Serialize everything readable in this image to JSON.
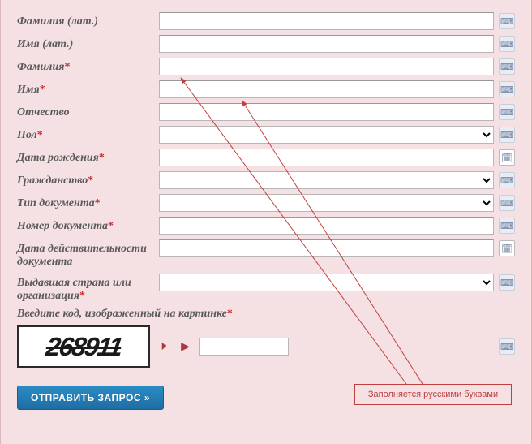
{
  "fields": {
    "surname_lat": {
      "label": "Фамилия (лат.)",
      "required": false,
      "value": ""
    },
    "name_lat": {
      "label": "Имя (лат.)",
      "required": false,
      "value": ""
    },
    "surname": {
      "label": "Фамилия",
      "required": true,
      "value": ""
    },
    "name": {
      "label": "Имя",
      "required": true,
      "value": ""
    },
    "patronymic": {
      "label": "Отчество",
      "required": false,
      "value": ""
    },
    "gender": {
      "label": "Пол",
      "required": true,
      "value": ""
    },
    "birth_date": {
      "label": "Дата рождения",
      "required": true,
      "value": ""
    },
    "citizenship": {
      "label": "Гражданство",
      "required": true,
      "value": ""
    },
    "doc_type": {
      "label": "Тип документа",
      "required": true,
      "value": ""
    },
    "doc_number": {
      "label": "Номер документа",
      "required": true,
      "value": ""
    },
    "doc_valid": {
      "label": "Дата действительности документа",
      "required": false,
      "value": ""
    },
    "issuer": {
      "label": "Выдавшая страна или организация",
      "required": true,
      "value": ""
    }
  },
  "captcha": {
    "label": "Введите код, изображенный на картинке",
    "required": true,
    "code": "268911",
    "value": ""
  },
  "note": "Заполняется русскими буквами",
  "submit": "ОТПРАВИТЬ ЗАПРОС »",
  "req_mark": "*"
}
